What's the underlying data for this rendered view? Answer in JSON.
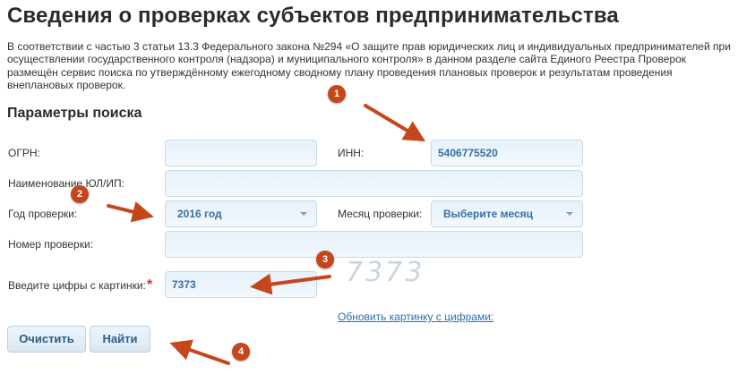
{
  "page_title": "Сведения о проверках субъектов предпринимательства",
  "intro": {
    "line1": "В соответствии с частью 3 статьи 13.3 Федерального закона №294 «О защите прав юридических лиц и индивидуальных предпринимателей при",
    "line2": "осуществлении государственного контроля (надзора) и муниципального контроля» в данном разделе сайта Единого Реестра Проверок",
    "line3": "размещён сервис поиска по утверждённому ежегодному сводному плану проведения плановых проверок и результатам проведения",
    "line4": "внеплановых проверок."
  },
  "search_params": {
    "heading": "Параметры поиска",
    "ogrn": {
      "label": "ОГРН:",
      "value": ""
    },
    "inn": {
      "label": "ИНН:",
      "value": "5406775520"
    },
    "name": {
      "label": "Наименование ЮЛ/ИП:",
      "value": ""
    },
    "year": {
      "label": "Год проверки:",
      "selected": "2016 год"
    },
    "month": {
      "label": "Месяц проверки:",
      "selected": "Выберите месяц"
    },
    "check_number": {
      "label": "Номер проверки:",
      "value": ""
    },
    "captcha": {
      "label": "Введите цифры с картинки:",
      "required_mark": "*",
      "value": "7373",
      "image_text": "7373",
      "refresh_link": "Обновить картинку с цифрами:"
    }
  },
  "buttons": {
    "clear": "Очистить",
    "find": "Найти"
  },
  "annotations": {
    "marker_1": "1",
    "marker_2": "2",
    "marker_3": "3",
    "marker_4": "4",
    "color": "#c6461b"
  },
  "colors": {
    "field_background": "#e6f1fb",
    "field_border": "#c7d9e8",
    "field_text": "#3a6fa1",
    "link": "#2a6db3",
    "required": "#d9342b"
  }
}
